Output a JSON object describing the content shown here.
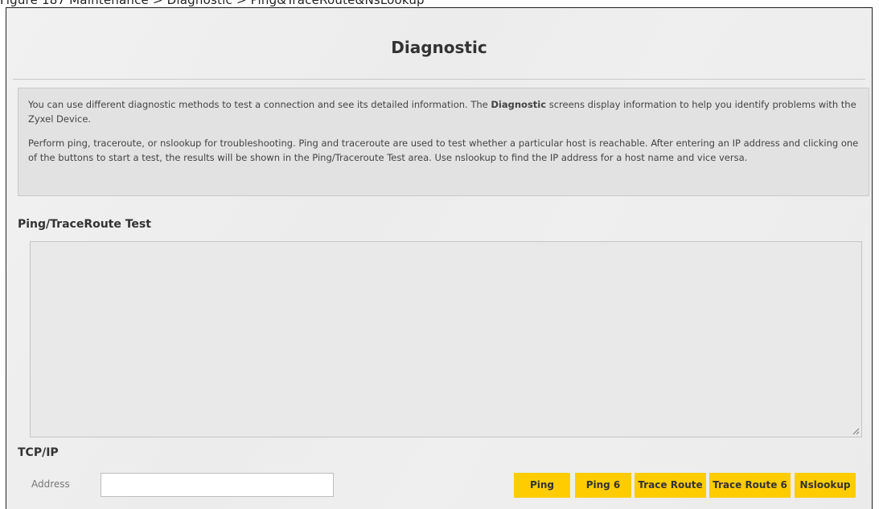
{
  "caption": "Figure 187   Maintenance > Diagnostic > Ping&TraceRoute&NsLookup",
  "page": {
    "title": "Diagnostic"
  },
  "info": {
    "para1_before": "You can use different diagnostic methods to test a connection and see its detailed information. The ",
    "para1_bold": "Diagnostic",
    "para1_after": " screens display information to help you identify problems with the Zyxel Device.",
    "para2": "Perform ping, traceroute, or nslookup for troubleshooting. Ping and traceroute are used to test whether a particular host is reachable. After entering an IP address and clicking one of the buttons to start a test, the results will be shown in the Ping/Traceroute Test area. Use nslookup to find the IP address for a host name and vice versa."
  },
  "ping_section": {
    "title": "Ping/TraceRoute Test",
    "result_text": ""
  },
  "tcpip_section": {
    "title": "TCP/IP",
    "address_label": "Address",
    "address_value": ""
  },
  "buttons": {
    "ping": "Ping",
    "ping6": "Ping 6",
    "trace_route": "Trace Route",
    "trace_route6": "Trace Route 6",
    "nslookup": "Nslookup"
  },
  "colors": {
    "button_bg": "#ffcc00",
    "panel_bg": "#e2e2e2"
  }
}
